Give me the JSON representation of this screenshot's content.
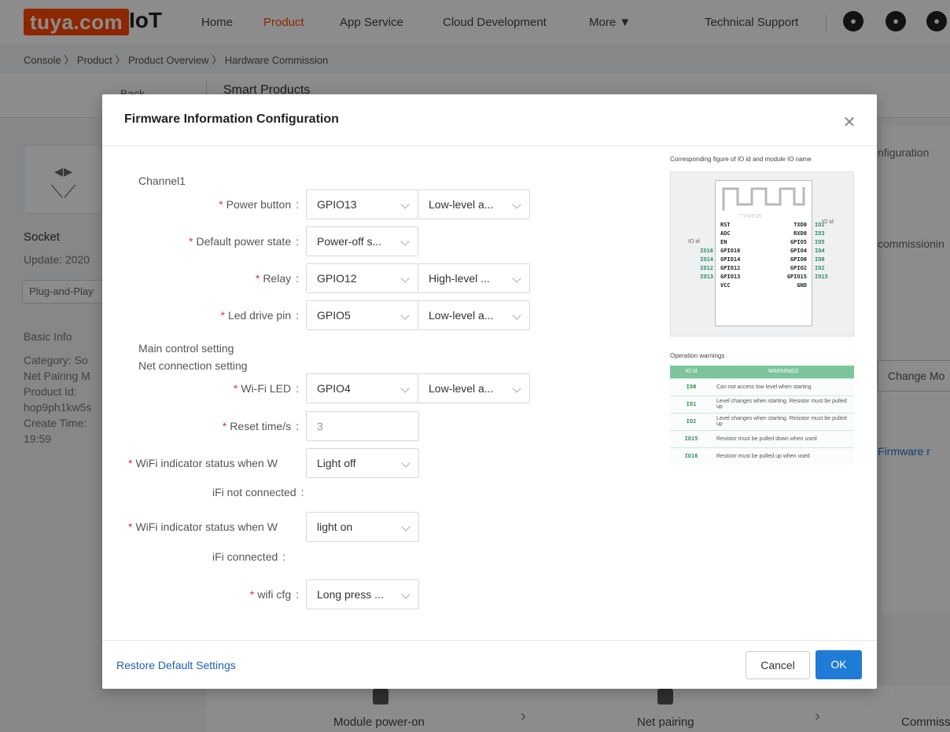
{
  "topbar": {
    "logo": "tuya.com",
    "product": "IoT",
    "nav": [
      "Home",
      "Product",
      "App Service",
      "Cloud Development",
      "More ▼"
    ],
    "tech_support": "Technical Support",
    "accent_color": "#ff4800"
  },
  "breadcrumb": "Console 〉 Product 〉 Product Overview 〉 Hardware Commission",
  "subbar": {
    "back": "← Back",
    "title": "Smart Products"
  },
  "left_panel": {
    "product_name": "Socket",
    "update": "Update: 2020",
    "tag": "Plug-and-Play",
    "basic_info": "Basic Info",
    "category": "Category: So",
    "net_pairing": "Net Pairing M",
    "product_id_label": "Product Id:",
    "product_id": "hop9ph1kw5s",
    "create_time_label": "Create Time:",
    "create_time": "19:59"
  },
  "right_panel": {
    "configuration": "nfiguration",
    "commissioning": "commissionin",
    "change_module": "Change Mo",
    "firmware_link": "Firmware r"
  },
  "steps": [
    "Module power-on",
    "Net pairing",
    "Commiss"
  ],
  "modal": {
    "title": "Firmware Information Configuration",
    "sections": {
      "channel1": "Channel1",
      "main_control": "Main control setting",
      "net_connection": "Net connection setting"
    },
    "fields": {
      "power_button": {
        "label": "Power button",
        "pin": "GPIO13",
        "level": "Low-level a..."
      },
      "default_power_state": {
        "label": "Default power state",
        "value": "Power-off s..."
      },
      "relay": {
        "label": "Relay",
        "pin": "GPIO12",
        "level": "High-level ..."
      },
      "led_drive_pin": {
        "label": "Led drive pin",
        "pin": "GPIO5",
        "level": "Low-level a..."
      },
      "wifi_led": {
        "label": "Wi-Fi LED",
        "pin": "GPIO4",
        "level": "Low-level a..."
      },
      "reset_time": {
        "label": "Reset time/s",
        "value": "3"
      },
      "wifi_not_connected": {
        "label_line1": "WiFi indicator status when W",
        "label_line2": "iFi not connected",
        "value": "Light off"
      },
      "wifi_connected": {
        "label_line1": "WiFi indicator status when W",
        "label_line2": "iFi connected",
        "value": "light on"
      },
      "wifi_cfg": {
        "label": "wifi cfg",
        "value": "Long press ..."
      }
    },
    "figure": {
      "title": "Corresponding figure of IO id and module IO name",
      "io_id_label": "IO id",
      "module_name": "TYWE3S",
      "left_pins": [
        "RST",
        "ADC",
        "EN",
        "GPIO16",
        "GPIO14",
        "GPIO12",
        "GPIO13",
        "VCC"
      ],
      "left_io": [
        "",
        "",
        "",
        "IO16",
        "IO14",
        "IO12",
        "IO13",
        ""
      ],
      "right_pins": [
        "TXD0",
        "RXD0",
        "GPIO5",
        "GPIO4",
        "GPIO0",
        "GPIO2",
        "GPIO15",
        "GND"
      ],
      "right_io": [
        "IO1",
        "IO3",
        "IO5",
        "IO4",
        "IO0",
        "IO2",
        "IO15",
        ""
      ]
    },
    "warnings": {
      "title": "Operation warnings",
      "headers": [
        "IO id",
        "WARNINGS"
      ],
      "rows": [
        {
          "io": "IO0",
          "text": "Can not access low level when starting"
        },
        {
          "io": "IO1",
          "text": "Level changes when starting. Resistor must be pulled up"
        },
        {
          "io": "IO2",
          "text": "Level changes when starting. Resistor must be pulled up"
        },
        {
          "io": "IO15",
          "text": "Resistor must be pulled down when used"
        },
        {
          "io": "IO16",
          "text": "Resistor must be pulled up when used"
        }
      ]
    },
    "footer": {
      "restore": "Restore Default Settings",
      "cancel": "Cancel",
      "ok": "OK"
    }
  }
}
